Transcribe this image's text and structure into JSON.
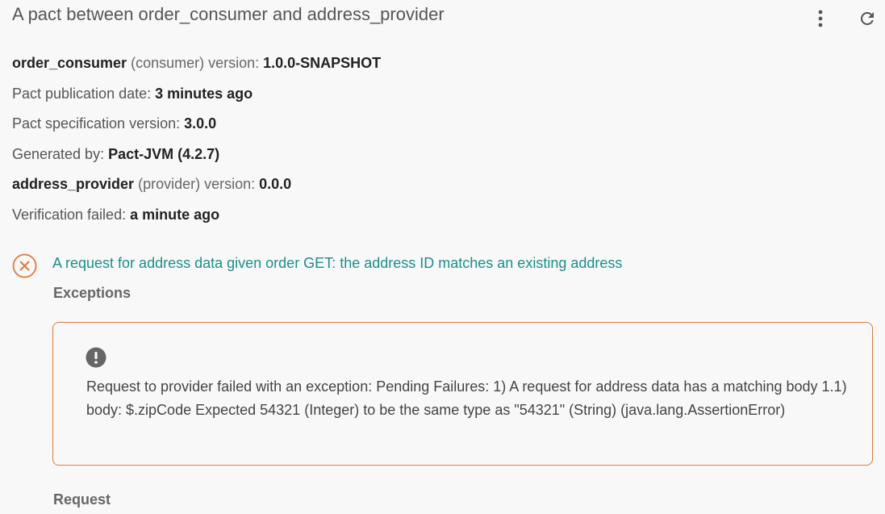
{
  "header": {
    "title": "A pact between order_consumer and address_provider",
    "icons": [
      "more-vertical-icon",
      "refresh-icon"
    ]
  },
  "meta": {
    "consumer_name": "order_consumer",
    "consumer_role": "(consumer) version: ",
    "consumer_version": "1.0.0-SNAPSHOT",
    "publication_label": "Pact publication date: ",
    "publication_value": "3 minutes ago",
    "spec_label": "Pact specification version: ",
    "spec_value": "3.0.0",
    "generated_label": "Generated by: ",
    "generated_value": "Pact-JVM (4.2.7)",
    "provider_name": "address_provider",
    "provider_role": "(provider) version: ",
    "provider_version": "0.0.0",
    "verification_label": "Verification failed: ",
    "verification_value": "a minute ago"
  },
  "interaction": {
    "status_icon": "failed-x-icon",
    "title": "A request for address data given order GET: the address ID matches an existing address",
    "exceptions_heading": "Exceptions",
    "exception_icon": "alert-circle-icon",
    "exception_message": "Request to provider failed with an exception: Pending Failures: 1) A request for address data has a matching body 1.1) body: $.zipCode Expected 54321 (Integer) to be the same type as \"54321\" (String) (java.lang.AssertionError)",
    "request_heading": "Request"
  },
  "colors": {
    "background": "#f8f8f8",
    "link": "#1a8f8a",
    "error_orange": "#e07b39",
    "text_dark": "#222222",
    "text_muted": "#555555"
  }
}
